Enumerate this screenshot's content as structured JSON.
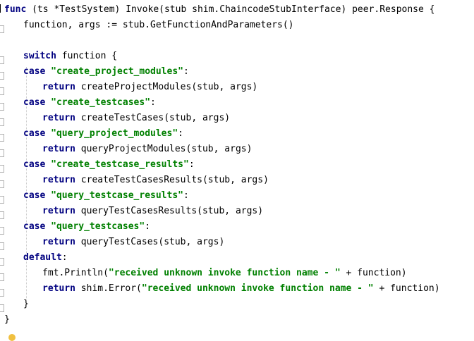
{
  "code": {
    "lines": [
      {
        "indent": 0,
        "segments": [
          {
            "t": "func",
            "c": "kw"
          },
          {
            "t": " (ts *TestSystem) Invoke(stub shim.ChaincodeStubInterface) peer.Response {",
            "c": "ident"
          }
        ]
      },
      {
        "indent": 1,
        "segments": [
          {
            "t": "function, args := stub.GetFunctionAndParameters()",
            "c": "ident"
          }
        ]
      },
      {
        "indent": 0,
        "segments": []
      },
      {
        "indent": 1,
        "segments": [
          {
            "t": "switch",
            "c": "kw"
          },
          {
            "t": " function {",
            "c": "ident"
          }
        ]
      },
      {
        "indent": 1,
        "segments": [
          {
            "t": "case",
            "c": "kw"
          },
          {
            "t": " ",
            "c": "ident"
          },
          {
            "t": "\"create_project_modules\"",
            "c": "str"
          },
          {
            "t": ":",
            "c": "ident"
          }
        ]
      },
      {
        "indent": 2,
        "segments": [
          {
            "t": "return",
            "c": "kw"
          },
          {
            "t": " createProjectModules(stub, args)",
            "c": "ident"
          }
        ]
      },
      {
        "indent": 1,
        "segments": [
          {
            "t": "case",
            "c": "kw"
          },
          {
            "t": " ",
            "c": "ident"
          },
          {
            "t": "\"create_testcases\"",
            "c": "str"
          },
          {
            "t": ":",
            "c": "ident"
          }
        ]
      },
      {
        "indent": 2,
        "segments": [
          {
            "t": "return",
            "c": "kw"
          },
          {
            "t": " createTestCases(stub, args)",
            "c": "ident"
          }
        ]
      },
      {
        "indent": 1,
        "segments": [
          {
            "t": "case",
            "c": "kw"
          },
          {
            "t": " ",
            "c": "ident"
          },
          {
            "t": "\"query_project_modules\"",
            "c": "str"
          },
          {
            "t": ":",
            "c": "ident"
          }
        ]
      },
      {
        "indent": 2,
        "segments": [
          {
            "t": "return",
            "c": "kw"
          },
          {
            "t": " queryProjectModules(stub, args)",
            "c": "ident"
          }
        ]
      },
      {
        "indent": 1,
        "segments": [
          {
            "t": "case",
            "c": "kw"
          },
          {
            "t": " ",
            "c": "ident"
          },
          {
            "t": "\"create_testcase_results\"",
            "c": "str"
          },
          {
            "t": ":",
            "c": "ident"
          }
        ]
      },
      {
        "indent": 2,
        "segments": [
          {
            "t": "return",
            "c": "kw"
          },
          {
            "t": " createTestCasesResults(stub, args)",
            "c": "ident"
          }
        ]
      },
      {
        "indent": 1,
        "segments": [
          {
            "t": "case",
            "c": "kw"
          },
          {
            "t": " ",
            "c": "ident"
          },
          {
            "t": "\"query_testcase_results\"",
            "c": "str"
          },
          {
            "t": ":",
            "c": "ident"
          }
        ]
      },
      {
        "indent": 2,
        "segments": [
          {
            "t": "return",
            "c": "kw"
          },
          {
            "t": " queryTestCasesResults(stub, args)",
            "c": "ident"
          }
        ]
      },
      {
        "indent": 1,
        "segments": [
          {
            "t": "case",
            "c": "kw"
          },
          {
            "t": " ",
            "c": "ident"
          },
          {
            "t": "\"query_testcases\"",
            "c": "str"
          },
          {
            "t": ":",
            "c": "ident"
          }
        ]
      },
      {
        "indent": 2,
        "segments": [
          {
            "t": "return",
            "c": "kw"
          },
          {
            "t": " queryTestCases(stub, args)",
            "c": "ident"
          }
        ]
      },
      {
        "indent": 1,
        "segments": [
          {
            "t": "default",
            "c": "kw"
          },
          {
            "t": ":",
            "c": "ident"
          }
        ]
      },
      {
        "indent": 2,
        "segments": [
          {
            "t": "fmt.Println(",
            "c": "ident"
          },
          {
            "t": "\"received unknown invoke function name - \"",
            "c": "str"
          },
          {
            "t": " + function)",
            "c": "ident"
          }
        ]
      },
      {
        "indent": 2,
        "segments": [
          {
            "t": "return",
            "c": "kw"
          },
          {
            "t": " shim.Error(",
            "c": "ident"
          },
          {
            "t": "\"received unknown invoke function name - \"",
            "c": "str"
          },
          {
            "t": " + function)",
            "c": "ident"
          }
        ]
      },
      {
        "indent": 1,
        "segments": [
          {
            "t": "}",
            "c": "ident"
          }
        ]
      },
      {
        "indent": 0,
        "segments": [
          {
            "t": "}",
            "c": "ident"
          }
        ]
      }
    ]
  },
  "colors": {
    "keyword": "#000080",
    "string": "#008000",
    "text": "#000000",
    "background": "#ffffff"
  },
  "icons": {
    "gutter_fold": "fold-marker-icon",
    "bottom_hint": "lightbulb-icon"
  }
}
